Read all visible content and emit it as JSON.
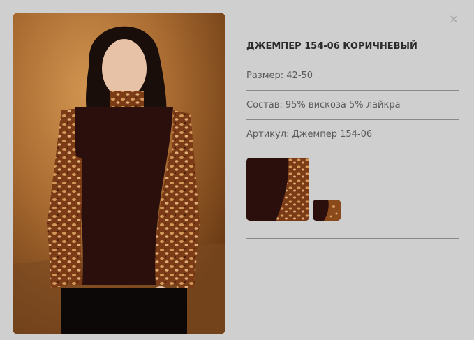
{
  "modal": {
    "close_label": "×",
    "product": {
      "title": "ДЖЕМПЕР 154-06 КОРИЧНЕВЫЙ",
      "size": "Размер: 42-50",
      "composition": "Состав: 95% вискоза 5% лайкра",
      "article": "Артикул: Джемпер 154-06"
    },
    "colors": {
      "background": "#cfcfcf",
      "garment": "#2a0f0c",
      "print": "#8a4a1c",
      "divider": "#8a8a8a"
    }
  }
}
